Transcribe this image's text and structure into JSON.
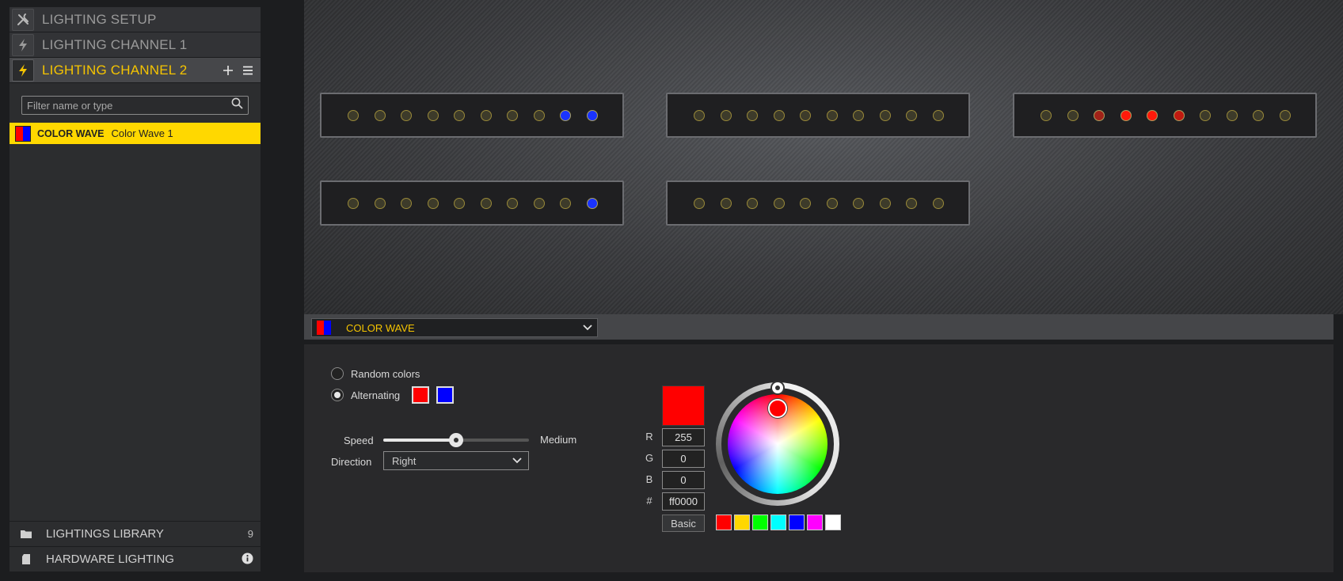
{
  "sidebar": {
    "nav": [
      {
        "label": "LIGHTING SETUP",
        "icon": "tools-icon"
      },
      {
        "label": "LIGHTING CHANNEL 1",
        "icon": "lightning-icon"
      },
      {
        "label": "LIGHTING CHANNEL 2",
        "icon": "lightning-icon",
        "active": true
      }
    ],
    "filter_placeholder": "Filter name or type",
    "effect": {
      "type": "COLOR WAVE",
      "name": "Color Wave 1"
    },
    "library": {
      "label": "LIGHTINGS LIBRARY",
      "count": "9"
    },
    "hardware": {
      "label": "HARDWARE LIGHTING"
    }
  },
  "led_strips": [
    {
      "leds": [
        "off",
        "off",
        "off",
        "off",
        "off",
        "off",
        "off",
        "off",
        "#1a33ff",
        "#1a33ff"
      ]
    },
    {
      "leds": [
        "off",
        "off",
        "off",
        "off",
        "off",
        "off",
        "off",
        "off",
        "off",
        "off"
      ]
    },
    {
      "leds": [
        "off",
        "off",
        "#a02218",
        "#ff1a0a",
        "#ff1a0a",
        "#c01a10",
        "off",
        "off",
        "off",
        "off"
      ]
    },
    {
      "leds": [
        "off",
        "off",
        "off",
        "off",
        "off",
        "off",
        "off",
        "off",
        "off",
        "#1a33ff"
      ]
    },
    {
      "leds": [
        "off",
        "off",
        "off",
        "off",
        "off",
        "off",
        "off",
        "off",
        "off",
        "off"
      ]
    }
  ],
  "effect_selector": {
    "label": "COLOR WAVE",
    "colors": [
      "#ff0000",
      "#0000ff"
    ]
  },
  "settings": {
    "random_colors_label": "Random colors",
    "alternating_label": "Alternating",
    "selected_mode": "alternating",
    "alt_colors": [
      "#ff0000",
      "#0000ff"
    ],
    "speed_label": "Speed",
    "speed_value": "Medium",
    "speed_fraction": 0.5,
    "direction_label": "Direction",
    "direction_value": "Right"
  },
  "color_picker": {
    "current_color": "#ff0000",
    "r_label": "R",
    "r": "255",
    "g_label": "G",
    "g": "0",
    "b_label": "B",
    "b": "0",
    "hex_label": "#",
    "hex": "ff0000",
    "basic_label": "Basic",
    "quick_colors": [
      "#ff0000",
      "#ffd700",
      "#00ff00",
      "#00ffff",
      "#0000ff",
      "#ff00ff",
      "#ffffff"
    ]
  }
}
